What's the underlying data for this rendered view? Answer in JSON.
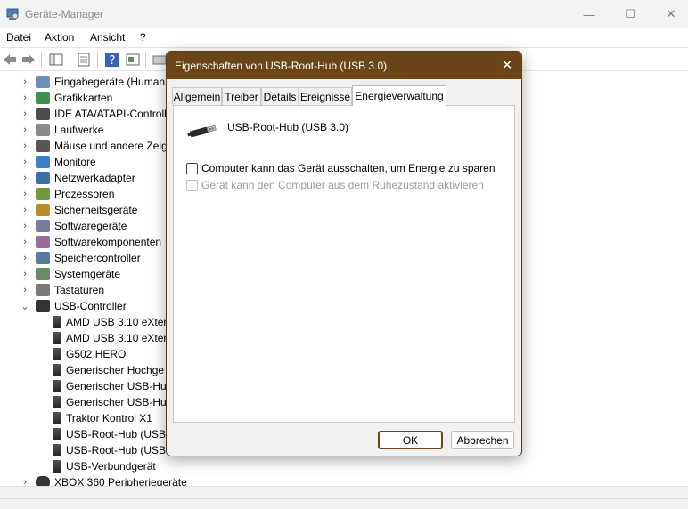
{
  "window": {
    "title": "Geräte-Manager",
    "controls": {
      "minimize": "—",
      "maximize": "☐",
      "close": "✕"
    }
  },
  "menu": [
    "Datei",
    "Aktion",
    "Ansicht",
    "?"
  ],
  "tree": [
    {
      "label": "Eingabegeräte (Human",
      "expanded": false,
      "icon": "input-device-icon"
    },
    {
      "label": "Grafikkarten",
      "expanded": false,
      "icon": "display-adapter-icon"
    },
    {
      "label": "IDE ATA/ATAPI-Controll",
      "expanded": false,
      "icon": "ide-controller-icon"
    },
    {
      "label": "Laufwerke",
      "expanded": false,
      "icon": "disk-drive-icon"
    },
    {
      "label": "Mäuse und andere Zeig",
      "expanded": false,
      "icon": "mouse-icon"
    },
    {
      "label": "Monitore",
      "expanded": false,
      "icon": "monitor-icon"
    },
    {
      "label": "Netzwerkadapter",
      "expanded": false,
      "icon": "network-adapter-icon"
    },
    {
      "label": "Prozessoren",
      "expanded": false,
      "icon": "processor-icon"
    },
    {
      "label": "Sicherheitsgeräte",
      "expanded": false,
      "icon": "security-device-icon"
    },
    {
      "label": "Softwaregeräte",
      "expanded": false,
      "icon": "software-device-icon"
    },
    {
      "label": "Softwarekomponenten",
      "expanded": false,
      "icon": "software-component-icon"
    },
    {
      "label": "Speichercontroller",
      "expanded": false,
      "icon": "storage-controller-icon"
    },
    {
      "label": "Systemgeräte",
      "expanded": false,
      "icon": "system-device-icon"
    },
    {
      "label": "Tastaturen",
      "expanded": false,
      "icon": "keyboard-icon"
    },
    {
      "label": "USB-Controller",
      "expanded": true,
      "icon": "usb-icon"
    }
  ],
  "usb_children": [
    "AMD USB 3.10 eXten",
    "AMD USB 3.10 eXten",
    "G502 HERO",
    "Generischer Hochge",
    "Generischer USB-Hu",
    "Generischer USB-Hu",
    "Traktor Kontrol X1",
    "USB-Root-Hub (USB",
    "USB-Root-Hub (USB",
    "USB-Verbundgerät"
  ],
  "tree_last": "XBOX 360 Peripheriegeräte",
  "dialog": {
    "title": "Eigenschaften von USB-Root-Hub (USB 3.0)",
    "close": "✕",
    "tabs": [
      "Allgemein",
      "Treiber",
      "Details",
      "Ereignisse",
      "Energieverwaltung"
    ],
    "active_tab": "Energieverwaltung",
    "device_name": "USB-Root-Hub (USB 3.0)",
    "options": [
      {
        "label": "Computer kann das Gerät ausschalten, um Energie zu sparen",
        "checked": false,
        "enabled": true
      },
      {
        "label": "Gerät kann den Computer aus dem Ruhezustand aktivieren",
        "checked": false,
        "enabled": false
      }
    ],
    "ok": "OK",
    "cancel": "Abbrechen"
  },
  "colors": {
    "dialog_titlebar": "#6b4517",
    "accent": "#6b4517"
  }
}
